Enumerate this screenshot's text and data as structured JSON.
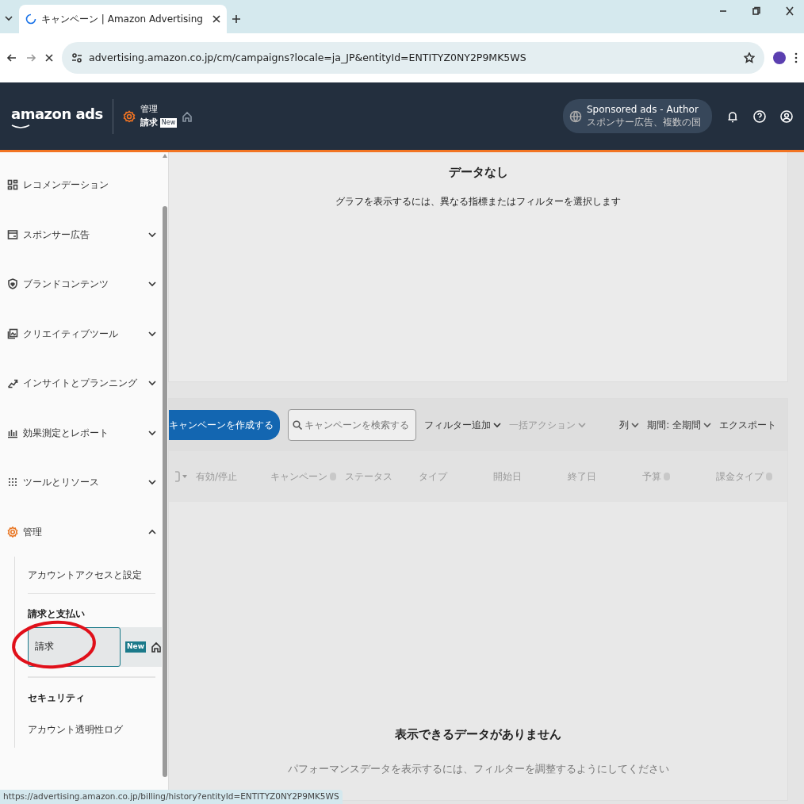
{
  "browser": {
    "tab_title": "キャンペーン | Amazon Advertising",
    "address": "advertising.amazon.co.jp/cm/campaigns?locale=ja_JP&entityId=ENTITYZ0NY2P9MK5WS"
  },
  "header": {
    "logo": "amazon ads",
    "breadcrumb": [
      "管理",
      "請求"
    ],
    "badge": "New",
    "account": {
      "title": "Sponsored ads - Author",
      "subtitle": "スポンサー広告、複数の国"
    }
  },
  "sidebar": {
    "items": [
      {
        "kind": "item",
        "label": "レコメンデーション"
      },
      {
        "kind": "item",
        "label": "スポンサー広告",
        "expanded": false
      },
      {
        "kind": "item",
        "label": "ブランドコンテンツ",
        "expanded": false
      },
      {
        "kind": "item",
        "label": "クリエイティブツール",
        "expanded": false
      },
      {
        "kind": "item",
        "label": "インサイトとプランニング",
        "expanded": false
      },
      {
        "kind": "item",
        "label": "効果測定とレポート",
        "expanded": false
      },
      {
        "kind": "item",
        "label": "ツールとリソース",
        "expanded": false
      },
      {
        "kind": "item",
        "label": "管理",
        "expanded": true,
        "children": [
          {
            "kind": "link",
            "label": "アカウントアクセスと設定",
            "selected": false
          },
          {
            "kind": "heading",
            "label": "請求と支払い"
          },
          {
            "kind": "link",
            "label": "請求",
            "selected": true,
            "badge": "New"
          },
          {
            "kind": "heading",
            "label": "セキュリティ"
          },
          {
            "kind": "link",
            "label": "アカウント透明性ログ",
            "selected": false
          }
        ]
      }
    ]
  },
  "chart_panel": {
    "title": "データなし",
    "message": "グラフを表示するには、異なる指標またはフィルターを選択します"
  },
  "toolbar": {
    "create_button": "キャンペーンを作成する",
    "search": {
      "placeholder": "キャンペーンを検索する"
    },
    "left_menus": [
      {
        "label": "フィルター追加",
        "disabled": false
      },
      {
        "label": "一括アクション",
        "disabled": true
      }
    ],
    "right_menus": [
      {
        "label": "列"
      },
      {
        "label": "期間: 全期間"
      }
    ],
    "export": "エクスポート"
  },
  "table": {
    "select_all_checked": false,
    "columns": [
      {
        "label": "有効/停止",
        "info": false
      },
      {
        "label": "キャンペーン",
        "info": true
      },
      {
        "label": "ステータス",
        "info": false
      },
      {
        "label": "タイプ",
        "info": false
      },
      {
        "label": "開始日",
        "info": false
      },
      {
        "label": "終了日",
        "info": false
      },
      {
        "label": "予算",
        "info": true
      },
      {
        "label": "課金タイプ",
        "info": true
      }
    ],
    "empty_title": "表示できるデータがありません",
    "empty_message": "パフォーマンスデータを表示するには、フィルターを調整するようにしてください"
  },
  "status_bar": "https://advertising.amazon.co.jp/billing/history?entityId=ENTITYZ0NY2P9MK5WS"
}
